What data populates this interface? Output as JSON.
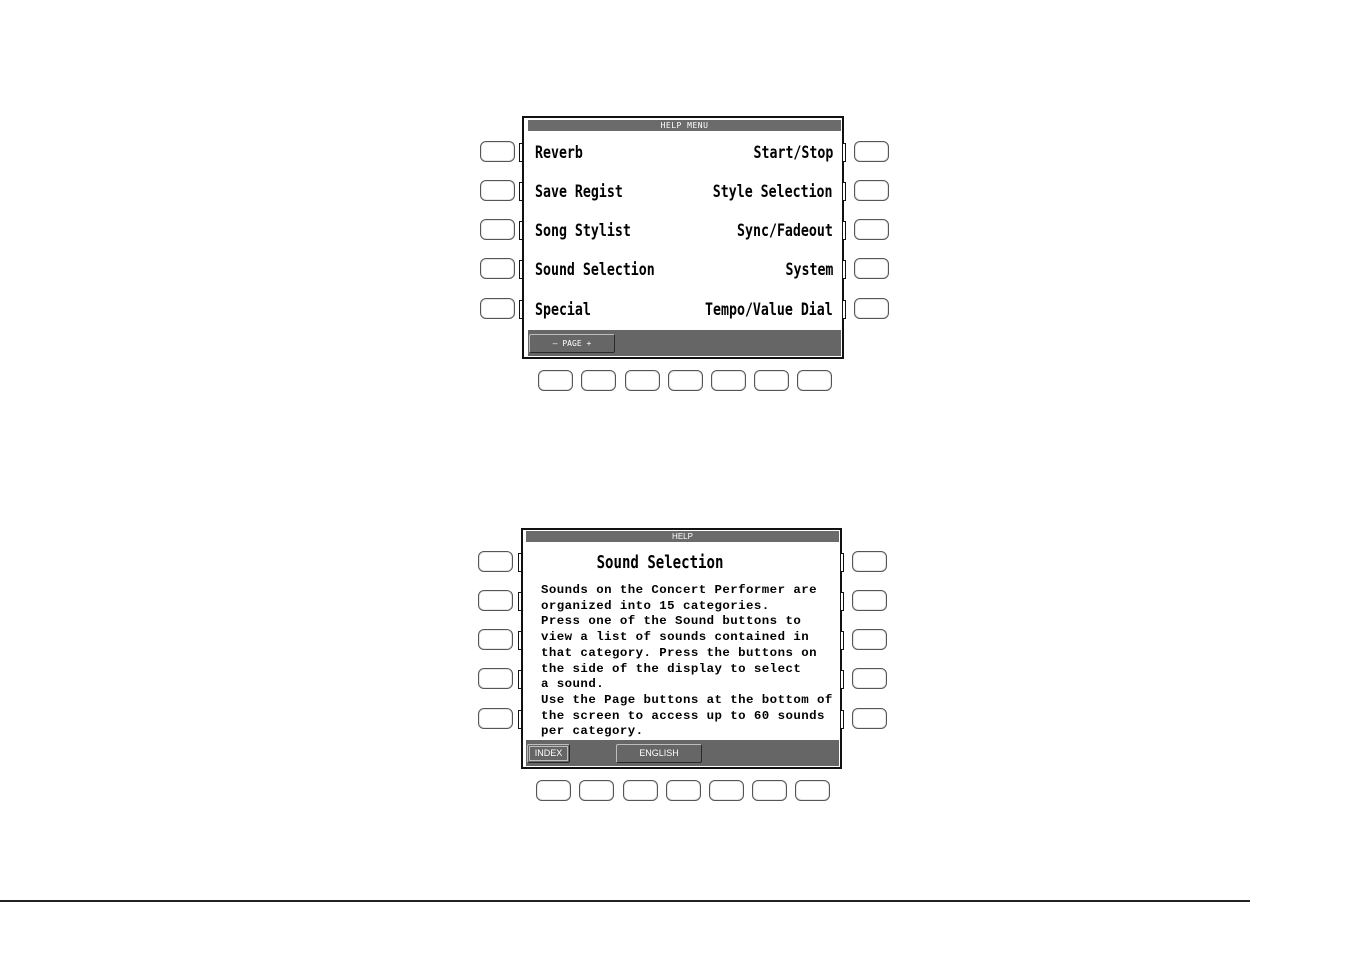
{
  "help_menu_screen": {
    "title": "HELP MENU",
    "left_items": [
      "Reverb",
      "Save Regist",
      "Song Stylist",
      "Sound Selection",
      "Special"
    ],
    "right_items": [
      "Start/Stop",
      "Style Selection",
      "Sync/Fadeout",
      "System",
      "Tempo/Value Dial"
    ],
    "page_button": "– PAGE +"
  },
  "help_screen": {
    "title": "HELP",
    "heading": "Sound Selection",
    "body_lines": [
      "Sounds on the Concert Performer are",
      "organized into 15 categories.",
      "Press one of the Sound buttons to",
      "view a list of sounds contained in",
      "that category. Press the buttons on",
      "the side of the display to select",
      "a sound.",
      "Use the Page buttons at the bottom of",
      "the screen to access up to 60 sounds",
      "per category."
    ],
    "index_button": "INDEX",
    "language_button": "ENGLISH"
  },
  "colors": {
    "title_bar": "#6b6b6b",
    "bottom_bar": "#666666",
    "frame": "#111111"
  }
}
